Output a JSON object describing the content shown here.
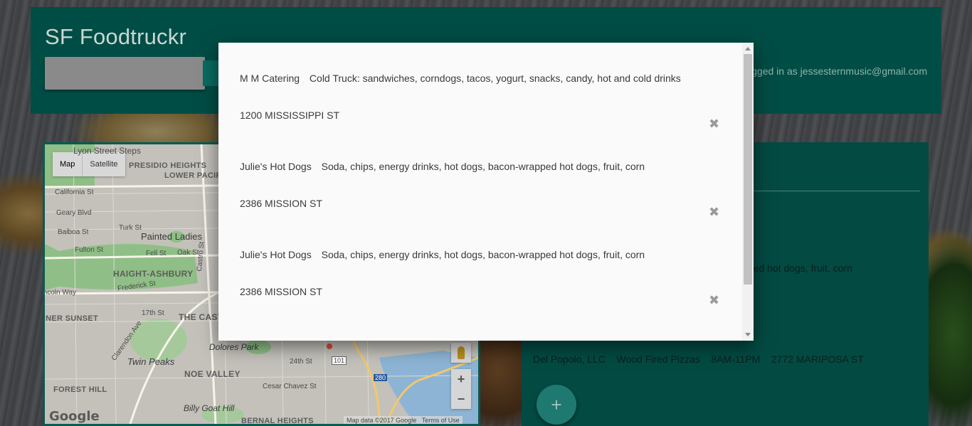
{
  "app": {
    "title": "SF Foodtruckr"
  },
  "header": {
    "logged_in_text": "Logged in as jessesternmusic@gmail.com"
  },
  "map": {
    "type_buttons": [
      "Map",
      "Satellite"
    ],
    "selected_type": "Map",
    "labels": {
      "lyon_street_steps": "Lyon Street Steps",
      "presidio_heights": "PRESIDIO HEIGHTS",
      "lower_pacific_heights": "LOWER PACIFIC HEIGHTS",
      "california_st": "California St",
      "geary_blvd": "Geary Blvd",
      "turk_st": "Turk St",
      "balboa_st": "Balboa St",
      "painted_ladies": "Painted Ladies",
      "fulton_st": "Fulton St",
      "fell_st": "Fell St",
      "oak_st": "Oak St",
      "haight_ashbury": "HAIGHT-ASHBURY",
      "castro_st": "Castro St",
      "frederick_st": "Frederick St",
      "lincoln_way": "Lincoln Way",
      "inner_sunset": "INNER SUNSET",
      "seventeenth_st": "17th St",
      "the_castro": "THE CASTRO",
      "clarendon_ave": "Clarendon Ave",
      "twin_peaks": "Twin Peaks",
      "noe_valley": "NOE VALLEY",
      "dolores_park": "Dolores Park",
      "twentyfourth_st": "24th St",
      "cesar_chavez_st": "Cesar Chavez St",
      "forest_hill": "FOREST HILL",
      "billy_goat_hill": "Billy Goat Hill",
      "bernal_heights": "BERNAL HEIGHTS",
      "highway_101": "101",
      "highway_280": "280"
    },
    "zoom_in": "+",
    "zoom_out": "−",
    "logo": "Google",
    "attribution": "Map data ©2017 Google",
    "terms": "Terms of Use"
  },
  "panel": {
    "partial_line": "pped hot dogs, fruit, corn",
    "entry": {
      "name": "Del Popolo, LLC",
      "food": "Wood Fired Pizzas",
      "hours": "8AM-11PM",
      "address": "2772 MARIPOSA ST"
    },
    "add_button": "+"
  },
  "modal": {
    "favorites": [
      {
        "name": "M M Catering",
        "food": "Cold Truck: sandwiches, corndogs, tacos, yogurt, snacks, candy, hot and cold drinks",
        "address": "1200 MISSISSIPPI ST"
      },
      {
        "name": "Julie's Hot Dogs",
        "food": "Soda, chips, energy drinks, hot dogs, bacon-wrapped hot dogs, fruit, corn",
        "address": "2386 MISSION ST"
      },
      {
        "name": "Julie's Hot Dogs",
        "food": "Soda, chips, energy drinks, hot dogs, bacon-wrapped hot dogs, fruit, corn",
        "address": "2386 MISSION ST"
      }
    ],
    "remove_glyph": "✖"
  }
}
